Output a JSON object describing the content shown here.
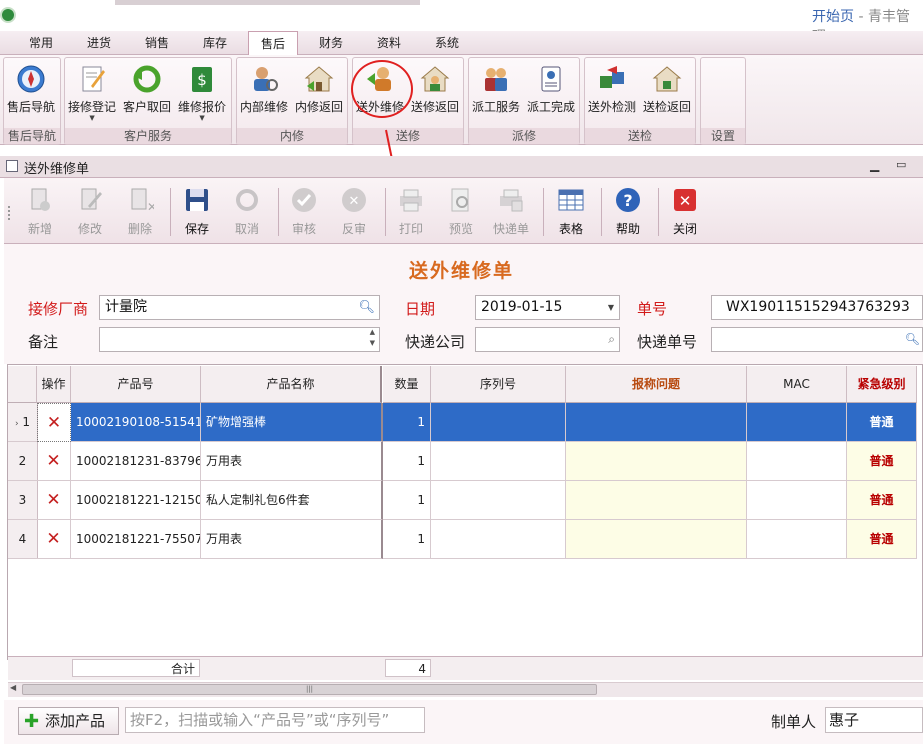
{
  "titlebar": {
    "start_page": "开始页",
    "app_name": " - 青丰管理"
  },
  "menu": {
    "tabs": [
      "常用",
      "进货",
      "销售",
      "库存",
      "售后",
      "财务",
      "资料",
      "系统"
    ],
    "active": "售后"
  },
  "ribbon": {
    "groups": [
      {
        "label": "售后导航",
        "buttons": [
          "售后导航"
        ]
      },
      {
        "label": "客户服务",
        "buttons": [
          "接修登记",
          "客户取回",
          "维修报价"
        ]
      },
      {
        "label": "内修",
        "buttons": [
          "内部维修",
          "内修返回"
        ]
      },
      {
        "label": "送修",
        "buttons": [
          "送外维修",
          "送修返回"
        ]
      },
      {
        "label": "派修",
        "buttons": [
          "派工服务",
          "派工完成"
        ]
      },
      {
        "label": "送检",
        "buttons": [
          "送外检测",
          "送检返回"
        ]
      },
      {
        "label": "设置",
        "buttons": []
      }
    ]
  },
  "document": {
    "tab_title": "送外维修单"
  },
  "toolbar": {
    "new": "新增",
    "edit": "修改",
    "delete": "删除",
    "save": "保存",
    "cancel": "取消",
    "audit": "审核",
    "unaudit": "反审",
    "print": "打印",
    "preview": "预览",
    "courier_slip": "快递单",
    "table": "表格",
    "help": "帮助",
    "close": "关闭"
  },
  "form": {
    "title": "送外维修单",
    "repairer_label": "接修厂商",
    "repairer_value": "计量院",
    "date_label": "日期",
    "date_value": "2019-01-15",
    "order_no_label": "单号",
    "order_no_value": "WX190115152943763293",
    "remark_label": "备注",
    "remark_value": "",
    "courier_label": "快递公司",
    "courier_value": "",
    "courier_no_label": "快递单号",
    "courier_no_value": ""
  },
  "grid": {
    "columns": [
      "操作",
      "产品号",
      "产品名称",
      "数量",
      "序列号",
      "报称问题",
      "MAC",
      "紧急级别"
    ],
    "rows": [
      {
        "no": "1",
        "product_no": "10002190108-51541",
        "name": "矿物增强棒",
        "qty": "1",
        "serial": "",
        "issue": "",
        "mac": "",
        "urgency": "普通"
      },
      {
        "no": "2",
        "product_no": "10002181231-83796",
        "name": "万用表",
        "qty": "1",
        "serial": "",
        "issue": "",
        "mac": "",
        "urgency": "普通"
      },
      {
        "no": "3",
        "product_no": "10002181221-12150",
        "name": "私人定制礼包6件套",
        "qty": "1",
        "serial": "",
        "issue": "",
        "mac": "",
        "urgency": "普通"
      },
      {
        "no": "4",
        "product_no": "10002181221-75507",
        "name": "万用表",
        "qty": "1",
        "serial": "",
        "issue": "",
        "mac": "",
        "urgency": "普通"
      }
    ],
    "footer_label": "合计",
    "footer_total_qty": "4"
  },
  "bottom": {
    "add_product": "添加产品",
    "scan_placeholder": "按F2，扫描或输入“产品号”或“序列号”",
    "maker_label": "制单人",
    "maker_value": "惠子"
  },
  "colors": {
    "accent_red": "#d21a1a",
    "selected_row": "#2e6bc7",
    "title_orange": "#d86a20"
  },
  "icons": [
    "compass-icon",
    "register-icon",
    "return-icon",
    "quote-icon",
    "internal-repair-icon",
    "home-return-icon",
    "outsource-repair-icon",
    "worker-icon",
    "badge-icon",
    "outsource-test-icon",
    "new-icon",
    "edit-icon",
    "delete-icon",
    "save-icon",
    "cancel-icon",
    "check-icon",
    "unaudit-icon",
    "printer-icon",
    "preview-icon",
    "courier-slip-icon",
    "table-icon",
    "help-icon",
    "close-icon"
  ]
}
